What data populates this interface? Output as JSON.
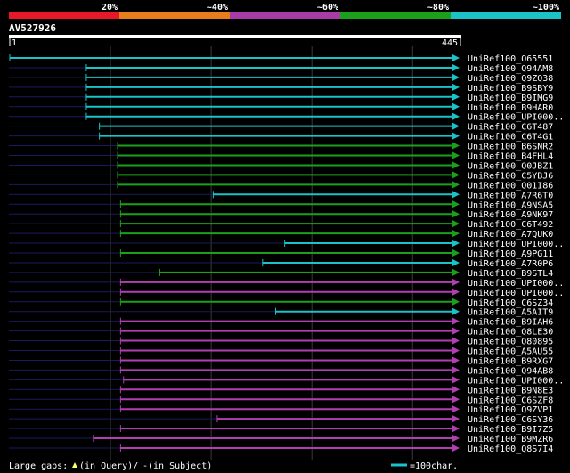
{
  "scale": {
    "labels": [
      "20%",
      "~40%",
      "~60%",
      "~80%",
      "~100%"
    ],
    "colors": [
      "#e8182a",
      "#e87d1d",
      "#a73ca7",
      "#1ca01c",
      "#19c3c8"
    ]
  },
  "query": {
    "name": "AV527926",
    "start": "1",
    "end": "445",
    "length": 445
  },
  "colors": {
    "cyan": "#19c3c8",
    "green": "#1ca01c",
    "magenta": "#b23fb2",
    "navy": "#1a1a5e",
    "grid": "#3a3a3a",
    "gap_marker": "#ffff66"
  },
  "hits": [
    {
      "name": "UniRef100_O65551",
      "color": "cyan",
      "start": 1,
      "end": 445
    },
    {
      "name": "UniRef100_Q94AM8",
      "color": "cyan",
      "start": 77,
      "end": 445
    },
    {
      "name": "UniRef100_Q9ZQ38",
      "color": "cyan",
      "start": 77,
      "end": 445
    },
    {
      "name": "UniRef100_B9SBY9",
      "color": "cyan",
      "start": 77,
      "end": 445
    },
    {
      "name": "UniRef100_B9IMG9",
      "color": "cyan",
      "start": 77,
      "end": 445
    },
    {
      "name": "UniRef100_B9HAR0",
      "color": "cyan",
      "start": 77,
      "end": 445
    },
    {
      "name": "UniRef100_UPI000..",
      "color": "cyan",
      "start": 77,
      "end": 445
    },
    {
      "name": "UniRef100_C6T487",
      "color": "cyan",
      "start": 90,
      "end": 445
    },
    {
      "name": "UniRef100_C6T4G1",
      "color": "cyan",
      "start": 90,
      "end": 445
    },
    {
      "name": "UniRef100_B6SNR2",
      "color": "green",
      "start": 108,
      "end": 445
    },
    {
      "name": "UniRef100_B4FHL4",
      "color": "green",
      "start": 108,
      "end": 445
    },
    {
      "name": "UniRef100_Q0JBZ1",
      "color": "green",
      "start": 108,
      "end": 445
    },
    {
      "name": "UniRef100_C5YBJ6",
      "color": "green",
      "start": 108,
      "end": 445
    },
    {
      "name": "UniRef100_Q01I86",
      "color": "green",
      "start": 108,
      "end": 445
    },
    {
      "name": "UniRef100_A7R6T0",
      "color": "cyan",
      "start": 203,
      "end": 445
    },
    {
      "name": "UniRef100_A9NSA5",
      "color": "green",
      "start": 111,
      "end": 445
    },
    {
      "name": "UniRef100_A9NK97",
      "color": "green",
      "start": 111,
      "end": 445
    },
    {
      "name": "UniRef100_C6T492",
      "color": "green",
      "start": 111,
      "end": 445
    },
    {
      "name": "UniRef100_A7QUK0",
      "color": "green",
      "start": 111,
      "end": 445
    },
    {
      "name": "UniRef100_UPI000..",
      "color": "cyan",
      "start": 274,
      "end": 445
    },
    {
      "name": "UniRef100_A9PG11",
      "color": "green",
      "start": 111,
      "end": 445
    },
    {
      "name": "UniRef100_A7R0P6",
      "color": "cyan",
      "start": 252,
      "end": 445
    },
    {
      "name": "UniRef100_B9STL4",
      "color": "green",
      "start": 150,
      "end": 445
    },
    {
      "name": "UniRef100_UPI000..",
      "color": "magenta",
      "start": 111,
      "end": 445
    },
    {
      "name": "UniRef100_UPI000..",
      "color": "magenta",
      "start": 111,
      "end": 445
    },
    {
      "name": "UniRef100_C6SZ34",
      "color": "green",
      "start": 111,
      "end": 445
    },
    {
      "name": "UniRef100_A5AIT9",
      "color": "cyan",
      "start": 265,
      "end": 445
    },
    {
      "name": "UniRef100_B9IAH6",
      "color": "magenta",
      "start": 111,
      "end": 445
    },
    {
      "name": "UniRef100_Q8LE30",
      "color": "magenta",
      "start": 111,
      "end": 445
    },
    {
      "name": "UniRef100_O80895",
      "color": "magenta",
      "start": 111,
      "end": 445
    },
    {
      "name": "UniRef100_A5AU55",
      "color": "magenta",
      "start": 111,
      "end": 445
    },
    {
      "name": "UniRef100_B9RXG7",
      "color": "magenta",
      "start": 111,
      "end": 445
    },
    {
      "name": "UniRef100_Q94AB8",
      "color": "magenta",
      "start": 111,
      "end": 445
    },
    {
      "name": "UniRef100_UPI000..",
      "color": "magenta",
      "start": 114,
      "end": 445
    },
    {
      "name": "UniRef100_B9N8E3",
      "color": "magenta",
      "start": 111,
      "end": 445
    },
    {
      "name": "UniRef100_C6SZF8",
      "color": "magenta",
      "start": 111,
      "end": 445
    },
    {
      "name": "UniRef100_Q9ZVP1",
      "color": "magenta",
      "start": 111,
      "end": 445
    },
    {
      "name": "UniRef100_C6SY36",
      "color": "magenta",
      "start": 207,
      "end": 445
    },
    {
      "name": "UniRef100_B9I7Z5",
      "color": "magenta",
      "start": 111,
      "end": 445
    },
    {
      "name": "UniRef100_B9MZR6",
      "color": "magenta",
      "start": 84,
      "end": 445
    },
    {
      "name": "UniRef100_Q8S7I4",
      "color": "magenta",
      "start": 111,
      "end": 445
    }
  ],
  "legend": {
    "gaps_label": "Large gaps:",
    "query_text": "(in Query)/",
    "subject_dash": "-",
    "subject_text": " (in Subject)",
    "scale_text": "=100char."
  }
}
